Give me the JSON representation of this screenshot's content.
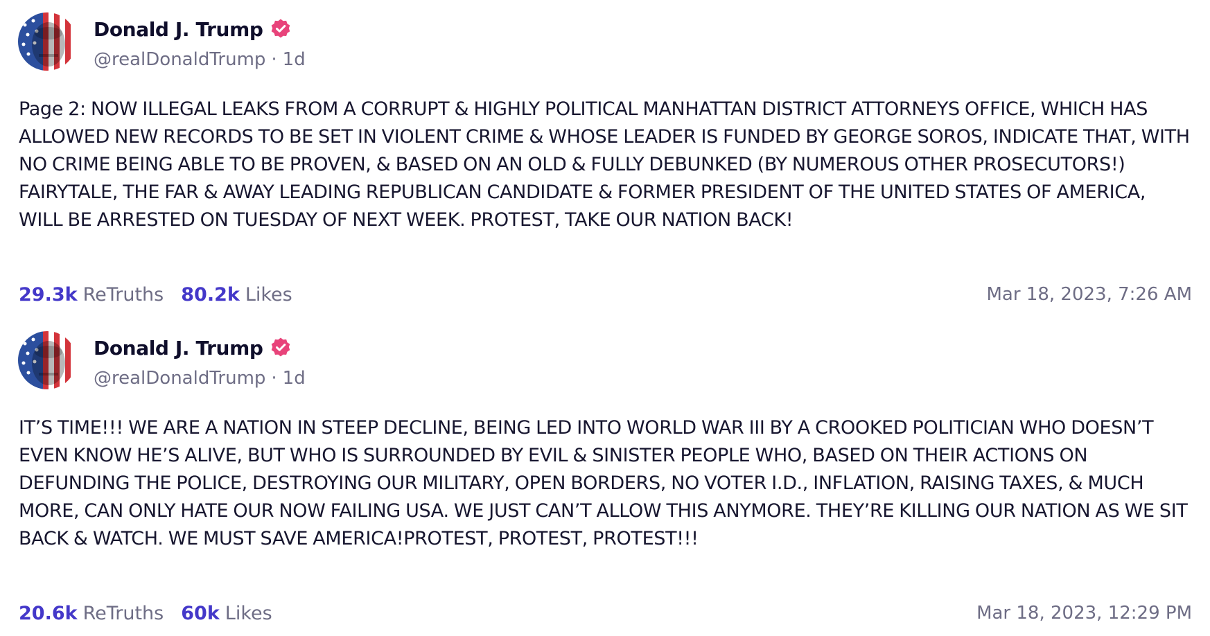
{
  "colors": {
    "accent": "#4438c9",
    "verified_badge": "#e8437a",
    "muted_text": "#6e6d85",
    "body_text": "#17162f"
  },
  "posts": [
    {
      "author": {
        "display_name": "Donald J. Trump",
        "handle": "@realDonaldTrump",
        "age": "1d",
        "verified_icon": "verified-badge-icon"
      },
      "text": "Page 2: NOW ILLEGAL LEAKS FROM A CORRUPT & HIGHLY POLITICAL MANHATTAN DISTRICT ATTORNEYS OFFICE, WHICH HAS ALLOWED NEW RECORDS TO BE SET IN VIOLENT CRIME & WHOSE LEADER IS FUNDED BY GEORGE SOROS, INDICATE THAT, WITH NO CRIME BEING ABLE TO BE PROVEN, & BASED ON AN OLD & FULLY DEBUNKED (BY NUMEROUS OTHER PROSECUTORS!) FAIRYTALE, THE FAR & AWAY LEADING REPUBLICAN CANDIDATE & FORMER PRESIDENT OF THE UNITED STATES OF AMERICA, WILL BE ARRESTED ON TUESDAY OF NEXT WEEK. PROTEST, TAKE OUR NATION BACK!",
      "retruths_count": "29.3k",
      "retruths_label": "ReTruths",
      "likes_count": "80.2k",
      "likes_label": "Likes",
      "timestamp": "Mar 18, 2023, 7:26 AM"
    },
    {
      "author": {
        "display_name": "Donald J. Trump",
        "handle": "@realDonaldTrump",
        "age": "1d",
        "verified_icon": "verified-badge-icon"
      },
      "text": "IT’S TIME!!! WE ARE A NATION IN STEEP DECLINE, BEING LED INTO WORLD WAR III BY A CROOKED POLITICIAN WHO DOESN’T EVEN KNOW HE’S ALIVE, BUT WHO IS SURROUNDED BY EVIL & SINISTER PEOPLE WHO, BASED ON THEIR ACTIONS ON DEFUNDING THE POLICE, DESTROYING OUR MILITARY, OPEN BORDERS, NO VOTER I.D., INFLATION, RAISING TAXES, & MUCH MORE, CAN ONLY HATE OUR NOW FAILING USA. WE JUST CAN’T ALLOW THIS ANYMORE. THEY’RE  KILLING OUR NATION AS WE SIT BACK & WATCH. WE MUST SAVE AMERICA!PROTEST, PROTEST, PROTEST!!!",
      "retruths_count": "20.6k",
      "retruths_label": "ReTruths",
      "likes_count": "60k",
      "likes_label": "Likes",
      "timestamp": "Mar 18, 2023, 12:29 PM"
    }
  ]
}
